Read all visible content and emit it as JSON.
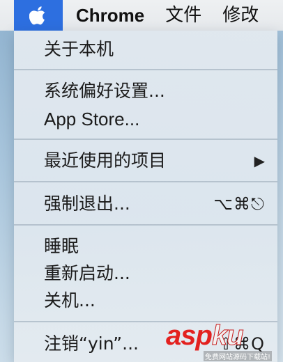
{
  "menubar": {
    "apple_icon": "apple-logo-icon",
    "app_name": "Chrome",
    "file": "文件",
    "edit": "修改"
  },
  "menu": {
    "about": "关于本机",
    "system_prefs": "系统偏好设置...",
    "app_store": "App Store...",
    "recent_items": "最近使用的项目",
    "recent_arrow": "▶",
    "force_quit": "强制退出...",
    "force_quit_shortcut": "⌥⌘⎋",
    "sleep": "睡眠",
    "restart": "重新启动...",
    "shutdown": "关机...",
    "logout": "注销“yin”...",
    "logout_shortcut": "⇧⌘Q"
  },
  "watermark": {
    "logo_a": "asp",
    "logo_b": "ku",
    "sub": "免费网站源码下载站!"
  },
  "colors": {
    "apple_highlight": "#2d6fe0",
    "watermark_red": "#e3211f"
  }
}
